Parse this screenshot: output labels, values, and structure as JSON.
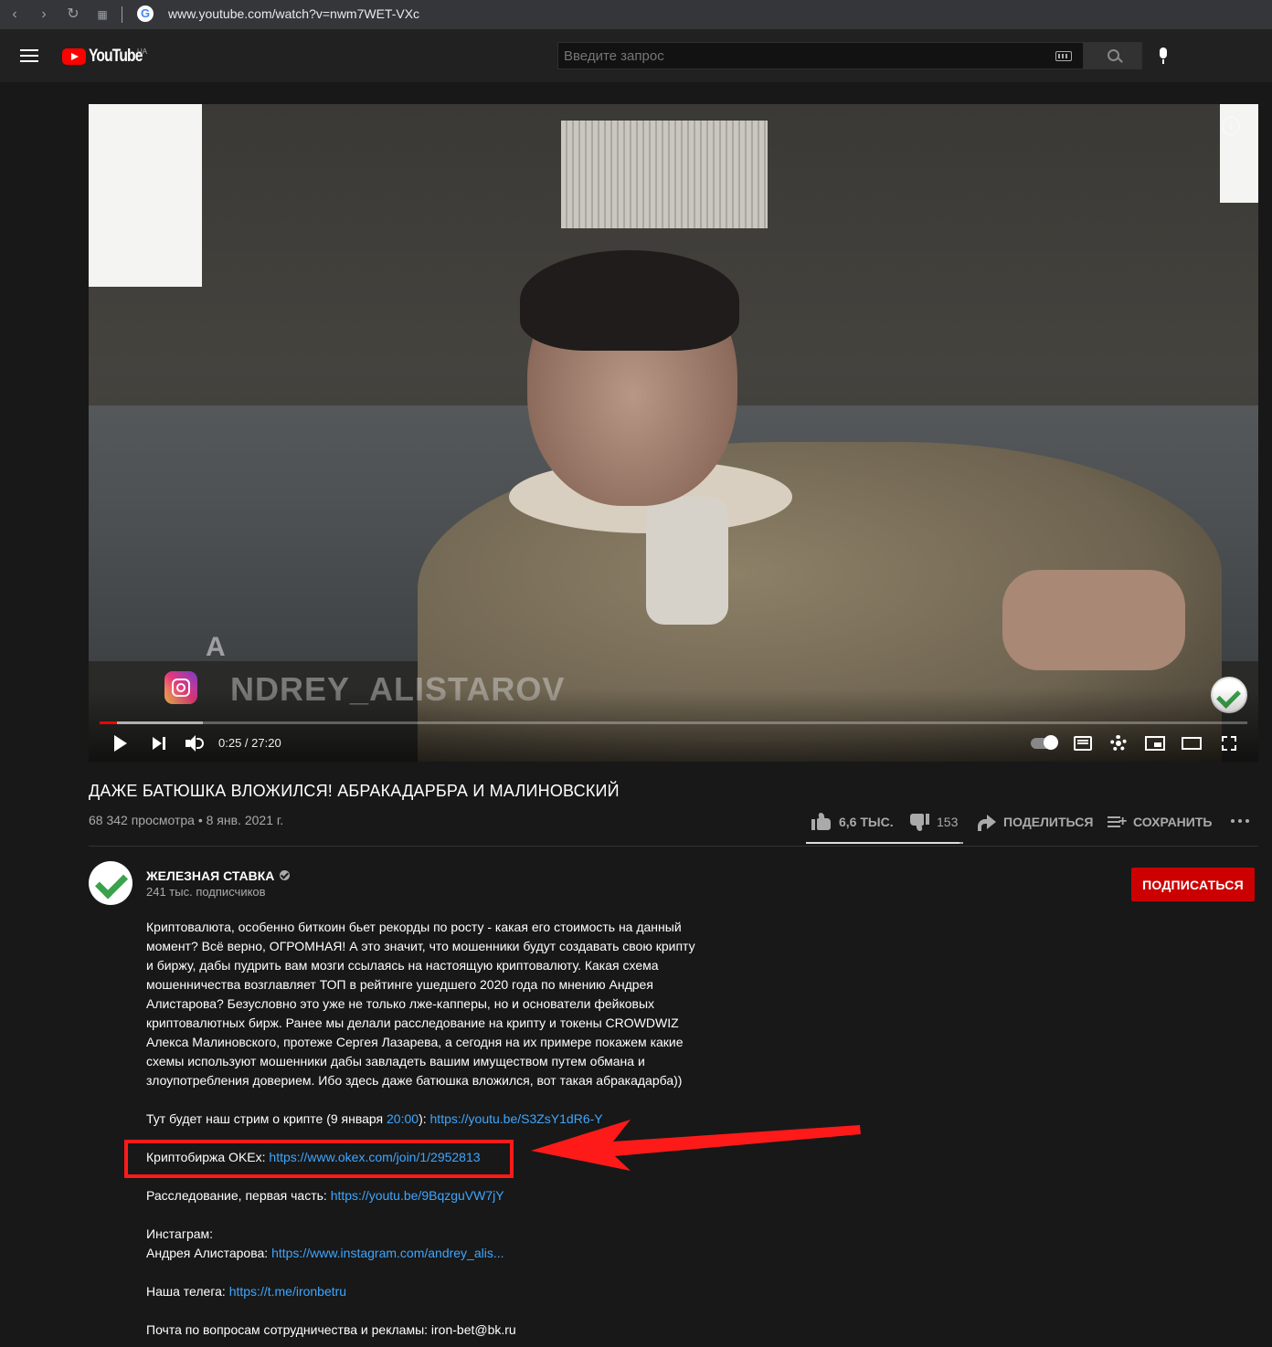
{
  "browser": {
    "url": "www.youtube.com/watch?v=nwm7WET-VXc",
    "nav_icons": [
      "back-icon",
      "forward-icon",
      "reload-icon",
      "apps-icon"
    ],
    "g_logo": "G"
  },
  "masthead": {
    "logo_text": "YouTube",
    "region": "UA",
    "search_placeholder": "Введите запрос"
  },
  "player": {
    "watermark_letter": "A",
    "watermark_name": "NDREY_ALISTAROV",
    "time": "0:25 / 27:20",
    "progress": 0.0152,
    "info_icon": "i"
  },
  "video": {
    "title": "ДАЖЕ БАТЮШКА ВЛОЖИЛСЯ! АБРАКАДАРБРА И МАЛИНОВСКИЙ",
    "meta": "68 342 просмотра • 8 янв. 2021 г.",
    "likes": "6,6 ТЫС.",
    "dislikes": "153",
    "like_ratio": 0.977,
    "share_label": "ПОДЕЛИТЬСЯ",
    "save_label": "СОХРАНИТЬ"
  },
  "channel": {
    "name": "ЖЕЛЕЗНАЯ СТАВКА",
    "subscribers": "241 тыс. подписчиков",
    "subscribe_label": "ПОДПИСАТЬСЯ"
  },
  "description": {
    "paragraph": [
      "Криптовалюта, особенно биткоин бьет рекорды по росту - какая его стоимость на данный",
      "момент? Всё верно, ОГРОМНАЯ! А это значит, что мошенники будут создавать свою крипту",
      "и биржу, дабы пудрить вам мозги ссылаясь на настоящую криптовалюту. Какая схема",
      "мошенничества возглавляет ТОП в рейтинге ушедшего 2020 года по мнению Андрея",
      "Алистарова? Безусловно это уже не только лже-капперы, но и основатели фейковых",
      "криптовалютных бирж. Ранее мы делали расследование на крипту и токены CROWDWIZ",
      "Алекса Малиновского, протеже Сергея Лазарева, а сегодня на их примере покажем какие",
      "схемы используют мошенники дабы завладеть вашим имуществом путем обмана и",
      "злоупотребления доверием. Ибо здесь даже батюшка вложился, вот такая абракадарба))"
    ],
    "stream_prefix": "Тут будет наш стрим о крипте (9 января ",
    "stream_time": "20:00",
    "stream_mid": "): ",
    "stream_link": "https://youtu.be/S3ZsY1dR6-Y",
    "okex_prefix": "Криптобиржа OKEx: ",
    "okex_link": "https://www.okex.com/join/1/2952813",
    "investigation_prefix": "Расследование, первая часть: ",
    "investigation_link": "https://youtu.be/9BqzguVW7jY",
    "instagram_heading": "Инстаграм:",
    "instagram_prefix": "Андрея Алистарова: ",
    "instagram_link": "https://www.instagram.com/andrey_alis...",
    "telegram_prefix": "Наша телега: ",
    "telegram_link": "https://t.me/ironbetru",
    "email_line": "Почта по вопросам сотрудничества и рекламы: iron-bet@bk.ru"
  },
  "colors": {
    "background": "#181818",
    "masthead": "#212121",
    "link": "#3ea6ff",
    "subscribe": "#cc0000",
    "annotation": "#ff1a1a"
  }
}
